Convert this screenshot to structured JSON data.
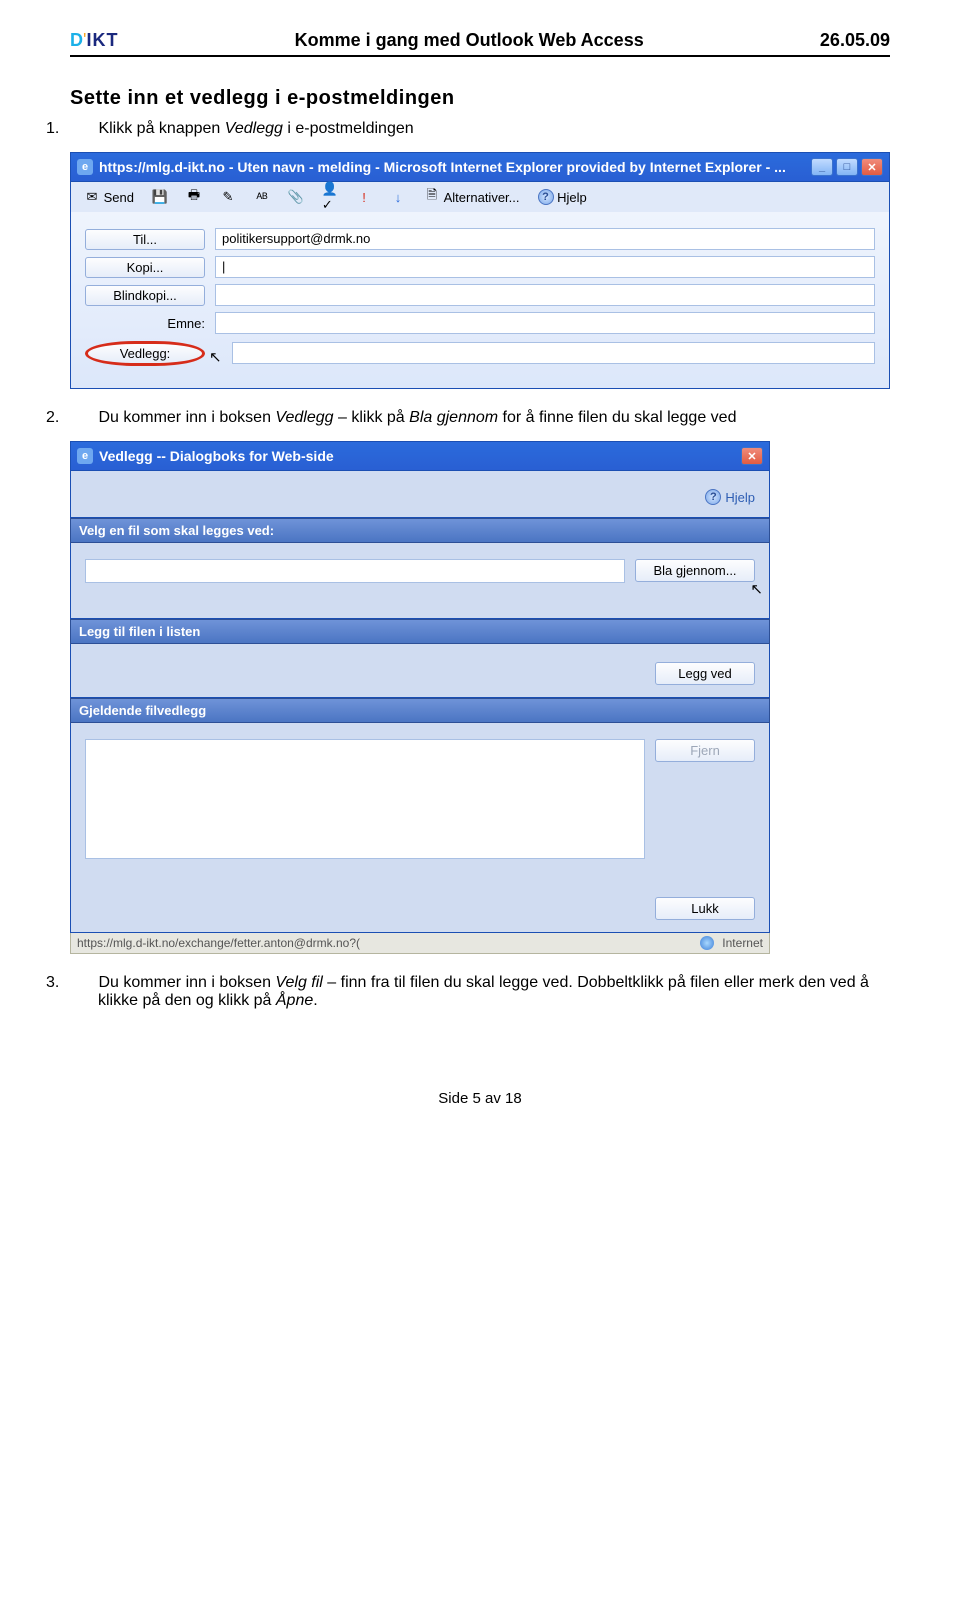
{
  "header": {
    "logo_d": "D",
    "logo_divider": "'",
    "logo_ikt": "IKT",
    "title": "Komme i gang med Outlook Web Access",
    "date": "26.05.09"
  },
  "section_title": "Sette inn et vedlegg i e-postmeldingen",
  "steps": {
    "s1": {
      "num": "1.",
      "pre": "Klikk på knappen ",
      "em": "Vedlegg",
      "post": " i e-postmeldingen"
    },
    "s2": {
      "num": "2.",
      "pre": "Du kommer inn i boksen ",
      "em1": "Vedlegg",
      "mid": " – klikk på ",
      "em2": "Bla gjennom",
      "post": " for å finne filen du skal legge ved"
    },
    "s3": {
      "num": "3.",
      "pre": "Du kommer inn i boksen ",
      "em1": "Velg fil",
      "mid": " – finn fra til filen du skal legge ved. Dobbeltklikk på filen eller merk den ved å klikke på den og klikk på ",
      "em2": "Åpne",
      "post": "."
    }
  },
  "shot1": {
    "title": "https://mlg.d-ikt.no - Uten navn - melding - Microsoft Internet Explorer provided by Internet Explorer  - ...",
    "toolbar": {
      "send": "Send",
      "alternativer": "Alternativer...",
      "hjelp": "Hjelp"
    },
    "form": {
      "til_btn": "Til...",
      "til_val": "politikersupport@drmk.no",
      "kopi_btn": "Kopi...",
      "kopi_val": "|",
      "blind_btn": "Blindkopi...",
      "blind_val": "",
      "emne_lbl": "Emne:",
      "emne_val": "",
      "vedl_btn": "Vedlegg:",
      "vedl_val": ""
    }
  },
  "shot2": {
    "title": "Vedlegg -- Dialogboks for Web-side",
    "hjelp": "Hjelp",
    "sec1": "Velg en fil som skal legges ved:",
    "browse": "Bla gjennom...",
    "sec2": "Legg til filen i listen",
    "legg_ved": "Legg ved",
    "sec3": "Gjeldende filvedlegg",
    "fjern": "Fjern",
    "lukk": "Lukk",
    "status_url": "https://mlg.d-ikt.no/exchange/fetter.anton@drmk.no?(",
    "status_zone": "Internet"
  },
  "footer": "Side 5 av 18"
}
